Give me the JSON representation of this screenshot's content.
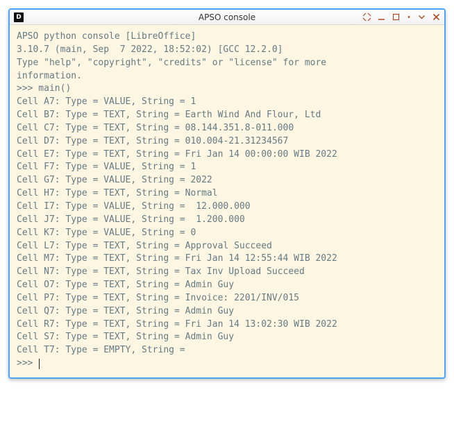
{
  "window": {
    "app_icon_letter": "D",
    "title": "APSO console"
  },
  "console": {
    "header1": "APSO python console [LibreOffice]",
    "header2": "3.10.7 (main, Sep  7 2022, 18:52:02) [GCC 12.2.0]",
    "header3": "Type \"help\", \"copyright\", \"credits\" or \"license\" for more",
    "header4": "information.",
    "prompt1": ">>> main()",
    "rows": [
      "Cell A7: Type = VALUE, String = 1",
      "Cell B7: Type = TEXT, String = Earth Wind And Flour, Ltd",
      "Cell C7: Type = TEXT, String = 08.144.351.8-011.000",
      "Cell D7: Type = TEXT, String = 010.004-21.31234567",
      "Cell E7: Type = TEXT, String = Fri Jan 14 00:00:00 WIB 2022",
      "Cell F7: Type = VALUE, String = 1",
      "Cell G7: Type = VALUE, String = 2022",
      "Cell H7: Type = TEXT, String = Normal",
      "Cell I7: Type = VALUE, String =  12.000.000",
      "Cell J7: Type = VALUE, String =  1.200.000",
      "Cell K7: Type = VALUE, String = 0",
      "Cell L7: Type = TEXT, String = Approval Succeed",
      "Cell M7: Type = TEXT, String = Fri Jan 14 12:55:44 WIB 2022",
      "Cell N7: Type = TEXT, String = Tax Inv Upload Succeed",
      "Cell O7: Type = TEXT, String = Admin Guy",
      "Cell P7: Type = TEXT, String = Invoice: 2201/INV/015",
      "Cell Q7: Type = TEXT, String = Admin Guy",
      "Cell R7: Type = TEXT, String = Fri Jan 14 13:02:30 WIB 2022",
      "Cell S7: Type = TEXT, String = Admin Guy",
      "Cell T7: Type = EMPTY, String = "
    ],
    "prompt2": ">>> "
  }
}
